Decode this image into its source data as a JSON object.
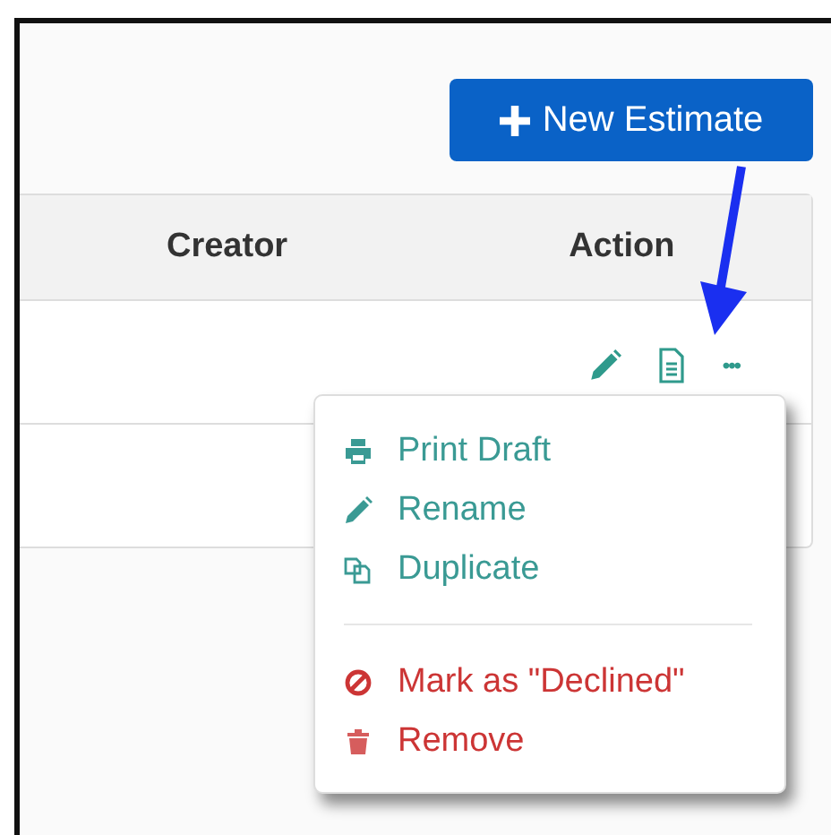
{
  "toolbar": {
    "new_button": "New Estimate"
  },
  "table": {
    "columns": [
      "Creator",
      "Action"
    ]
  },
  "row_actions": {
    "more": "•••"
  },
  "menu": {
    "groups": [
      [
        {
          "label": "Print Draft",
          "kind": "normal"
        },
        {
          "label": "Rename",
          "kind": "normal"
        },
        {
          "label": "Duplicate",
          "kind": "normal"
        }
      ],
      [
        {
          "label": "Mark as \"Declined\"",
          "kind": "danger"
        },
        {
          "label": "Remove",
          "kind": "danger"
        }
      ]
    ]
  }
}
